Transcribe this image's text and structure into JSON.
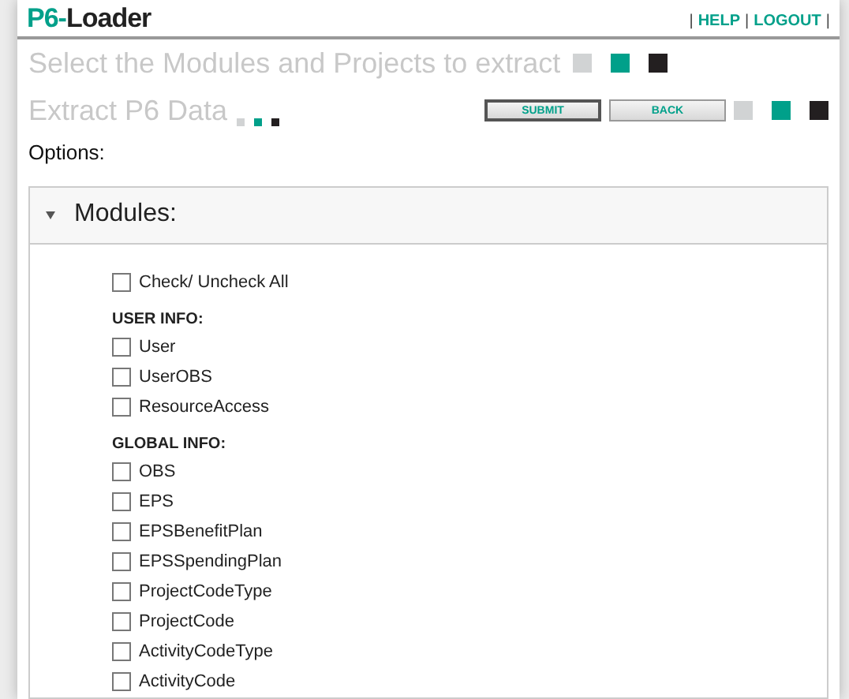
{
  "header": {
    "logo": {
      "prefix": "P6-",
      "suffix": "Loader"
    },
    "links": [
      "HELP",
      "LOGOUT"
    ],
    "separator": "|"
  },
  "page_title": "Select the Modules and Projects to extract",
  "section_title": "Extract P6 Data",
  "buttons": [
    "SUBMIT",
    "BACK"
  ],
  "options_label": "Options:",
  "panel": {
    "title": "Modules:",
    "expanded": true,
    "check_all": {
      "label": "Check/ Uncheck All",
      "checked": false
    },
    "groups": [
      {
        "title": "USER INFO:",
        "items": [
          {
            "label": "User",
            "checked": false
          },
          {
            "label": "UserOBS",
            "checked": false
          },
          {
            "label": "ResourceAccess",
            "checked": false
          }
        ]
      },
      {
        "title": "GLOBAL INFO:",
        "items": [
          {
            "label": "OBS",
            "checked": false
          },
          {
            "label": "EPS",
            "checked": false
          },
          {
            "label": "EPSBenefitPlan",
            "checked": false
          },
          {
            "label": "EPSSpendingPlan",
            "checked": false
          },
          {
            "label": "ProjectCodeType",
            "checked": false
          },
          {
            "label": "ProjectCode",
            "checked": false
          },
          {
            "label": "ActivityCodeType",
            "checked": false
          },
          {
            "label": "ActivityCode",
            "checked": false
          }
        ]
      }
    ]
  }
}
